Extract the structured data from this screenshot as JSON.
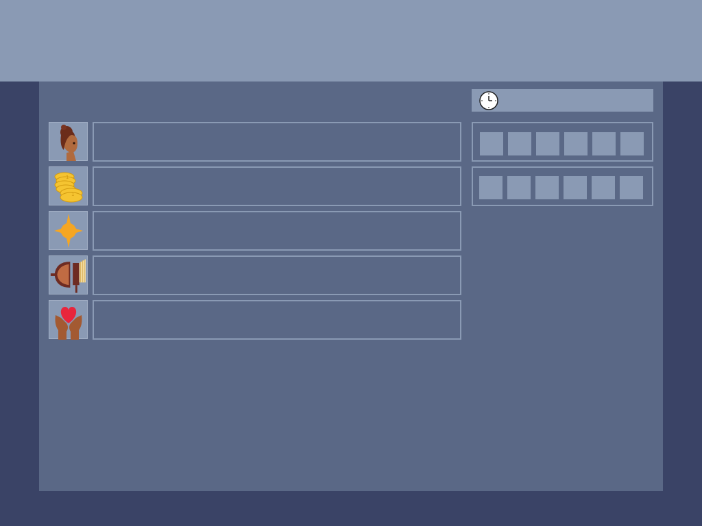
{
  "colors": {
    "background": "#3a4366",
    "top_band": "#8a9ab4",
    "panel": "#5a6886",
    "border": "#8a9ab4",
    "slot": "#8a9ab4"
  },
  "clock": {
    "icon": "clock-icon",
    "text": ""
  },
  "stats": [
    {
      "icon": "character-portrait-icon",
      "value": ""
    },
    {
      "icon": "gold-coins-icon",
      "value": ""
    },
    {
      "icon": "star-burst-icon",
      "value": ""
    },
    {
      "icon": "shield-brush-icon",
      "value": ""
    },
    {
      "icon": "heart-in-hands-icon",
      "value": ""
    }
  ],
  "inventory_rows": [
    {
      "slots": [
        "",
        "",
        "",
        "",
        "",
        ""
      ]
    },
    {
      "slots": [
        "",
        "",
        "",
        "",
        "",
        ""
      ]
    }
  ]
}
